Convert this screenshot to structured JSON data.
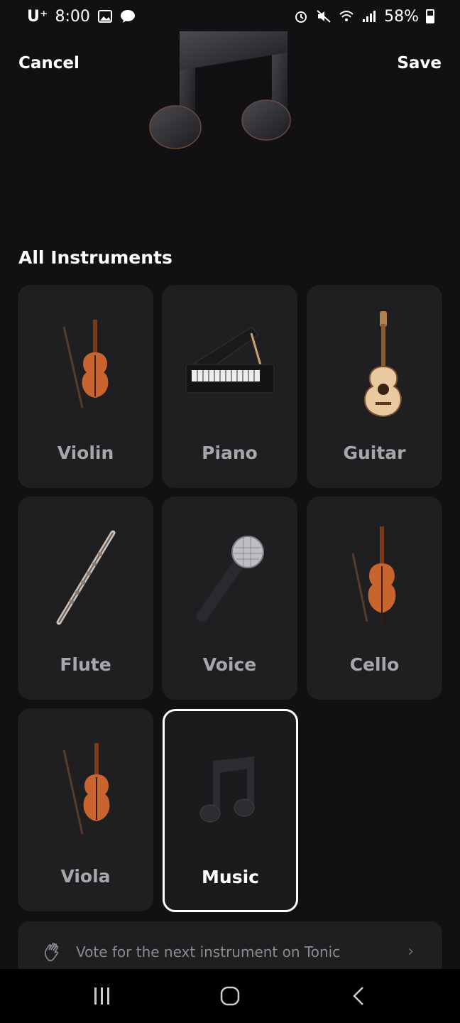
{
  "status_bar": {
    "carrier": "U⁺",
    "time": "8:00",
    "battery": "58%",
    "icons": [
      "gallery-icon",
      "talk-icon",
      "alarm-icon",
      "mute-icon",
      "wifi-icon",
      "signal-icon",
      "battery-icon"
    ]
  },
  "header": {
    "cancel_label": "Cancel",
    "save_label": "Save"
  },
  "section": {
    "title": "All Instruments"
  },
  "instruments": [
    {
      "label": "Violin",
      "icon": "violin-icon",
      "selected": false
    },
    {
      "label": "Piano",
      "icon": "piano-icon",
      "selected": false
    },
    {
      "label": "Guitar",
      "icon": "guitar-icon",
      "selected": false
    },
    {
      "label": "Flute",
      "icon": "flute-icon",
      "selected": false
    },
    {
      "label": "Voice",
      "icon": "microphone-icon",
      "selected": false
    },
    {
      "label": "Cello",
      "icon": "cello-icon",
      "selected": false
    },
    {
      "label": "Viola",
      "icon": "viola-icon",
      "selected": false
    },
    {
      "label": "Music",
      "icon": "music-note-icon",
      "selected": true
    }
  ],
  "vote": {
    "text": "Vote for the next instrument on Tonic",
    "icon": "wave-hand-icon"
  },
  "colors": {
    "background": "#111113",
    "card": "#1f1f22",
    "label_muted": "#a7a7ab",
    "wood": "#c8652e",
    "selected_border": "#ffffff"
  }
}
